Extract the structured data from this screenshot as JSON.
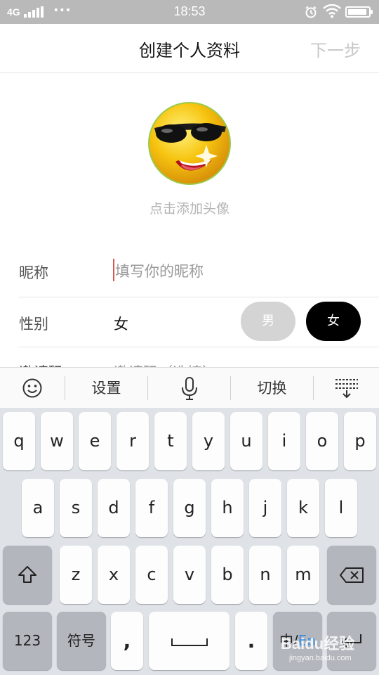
{
  "status_bar": {
    "network": "4G",
    "dots": "···",
    "time": "18:53",
    "icons": [
      "signal-icon",
      "alarm-icon",
      "wifi-icon",
      "battery-icon"
    ]
  },
  "header": {
    "title": "创建个人资料",
    "next_label": "下一步"
  },
  "avatar": {
    "icon": "sunglasses-emoji-avatar",
    "hint": "点击添加头像"
  },
  "form": {
    "nickname": {
      "label": "昵称",
      "value": "",
      "placeholder": "填写你的昵称"
    },
    "gender": {
      "label": "性别",
      "value": "女",
      "options": [
        "男",
        "女"
      ],
      "selected": "女"
    },
    "invite": {
      "label": "邀请码",
      "placeholder": "邀请码（选填）"
    }
  },
  "keyboard": {
    "toolbar": [
      "emoji-icon",
      "设置",
      "mic-icon",
      "切换",
      "collapse-keyboard-icon"
    ],
    "row1": [
      "q",
      "w",
      "e",
      "r",
      "t",
      "y",
      "u",
      "i",
      "o",
      "p"
    ],
    "row2": [
      "a",
      "s",
      "d",
      "f",
      "g",
      "h",
      "j",
      "k",
      "l"
    ],
    "row3": [
      "z",
      "x",
      "c",
      "v",
      "b",
      "n",
      "m"
    ],
    "bottom": {
      "numbers": "123",
      "symbols": "符号",
      "comma": ",",
      "period": ".",
      "lang_zh": "中/",
      "lang_en": "En"
    }
  },
  "watermark": {
    "text": "Baidu经验",
    "sub": "jingyan.baidu.com"
  },
  "colors": {
    "accent": "#000000",
    "caret": "#d9534f",
    "lang_highlight": "#3b8fe0"
  }
}
